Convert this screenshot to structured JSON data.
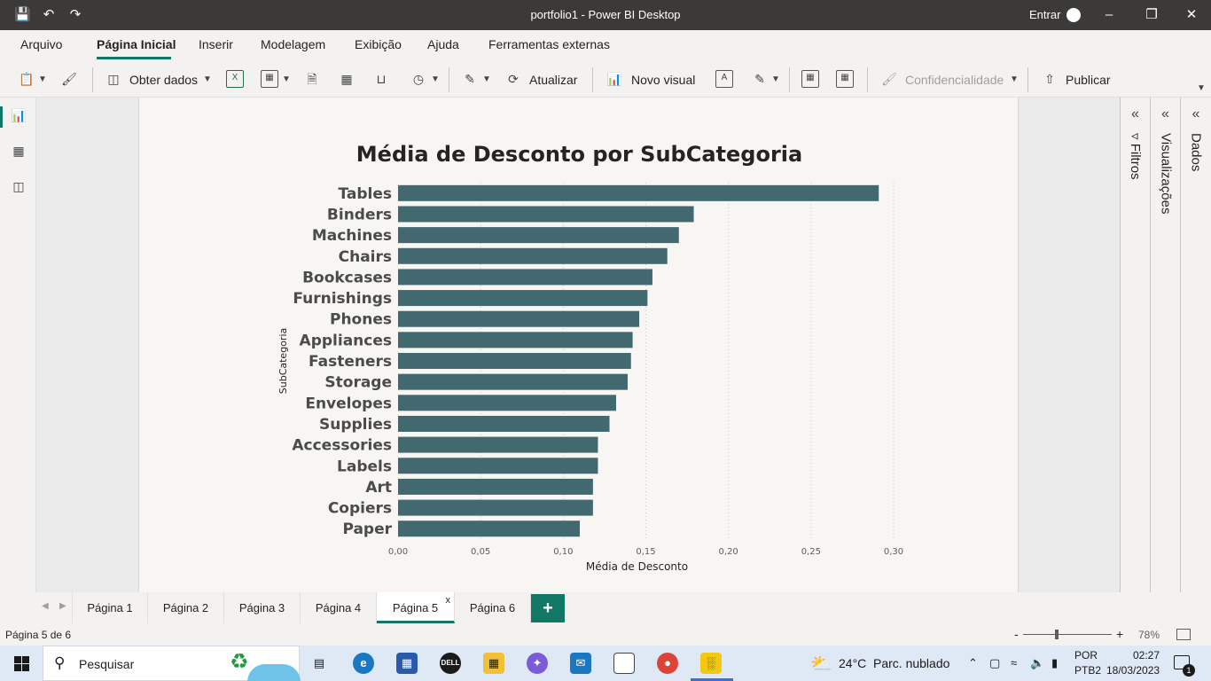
{
  "window": {
    "title": "portfolio1 - Power BI Desktop",
    "signin_label": "Entrar"
  },
  "menu": {
    "tabs": [
      "Arquivo",
      "Página Inicial",
      "Inserir",
      "Modelagem",
      "Exibição",
      "Ajuda",
      "Ferramentas externas"
    ],
    "active_tab": "Página Inicial"
  },
  "ribbon": {
    "get_data": "Obter dados",
    "refresh": "Atualizar",
    "new_visual": "Novo visual",
    "sensitivity": "Confidencialidade",
    "publish": "Publicar"
  },
  "panes": {
    "filters": "Filtros",
    "visualizations": "Visualizações",
    "data": "Dados"
  },
  "page_tabs": {
    "tabs": [
      "Página 1",
      "Página 2",
      "Página 3",
      "Página 4",
      "Página 5",
      "Página 6"
    ],
    "active": "Página 5",
    "close_glyph": "x",
    "add_glyph": "+"
  },
  "statusbar": {
    "page_info": "Página 5 de 6",
    "zoom": "78%",
    "zoom_minus": "-",
    "zoom_plus": "+"
  },
  "taskbar": {
    "search_placeholder": "Pesquisar",
    "weather_temp": "24°C",
    "weather_desc": "Parc. nublado",
    "lang_top": "POR",
    "lang_bottom": "PTB2",
    "time": "02:27",
    "date": "18/03/2023",
    "notification_count": "1"
  },
  "colors": {
    "accent": "#117865",
    "bar": "#426870",
    "canvas_bg": "#f7f6f2"
  },
  "chart_data": {
    "type": "bar",
    "orientation": "horizontal",
    "title": "Média de Desconto por SubCategoria",
    "xlabel": "Média de Desconto",
    "ylabel": "SubCategoria",
    "xlim": [
      0,
      0.3
    ],
    "xticks": [
      "0,00",
      "0,05",
      "0,10",
      "0,15",
      "0,20",
      "0,25",
      "0,30"
    ],
    "grid": "vertical dotted",
    "categories": [
      "Tables",
      "Binders",
      "Machines",
      "Chairs",
      "Bookcases",
      "Furnishings",
      "Phones",
      "Appliances",
      "Fasteners",
      "Storage",
      "Envelopes",
      "Supplies",
      "Accessories",
      "Labels",
      "Art",
      "Copiers",
      "Paper"
    ],
    "values": [
      0.291,
      0.179,
      0.17,
      0.163,
      0.154,
      0.151,
      0.146,
      0.142,
      0.141,
      0.139,
      0.132,
      0.128,
      0.121,
      0.121,
      0.118,
      0.118,
      0.11
    ]
  }
}
